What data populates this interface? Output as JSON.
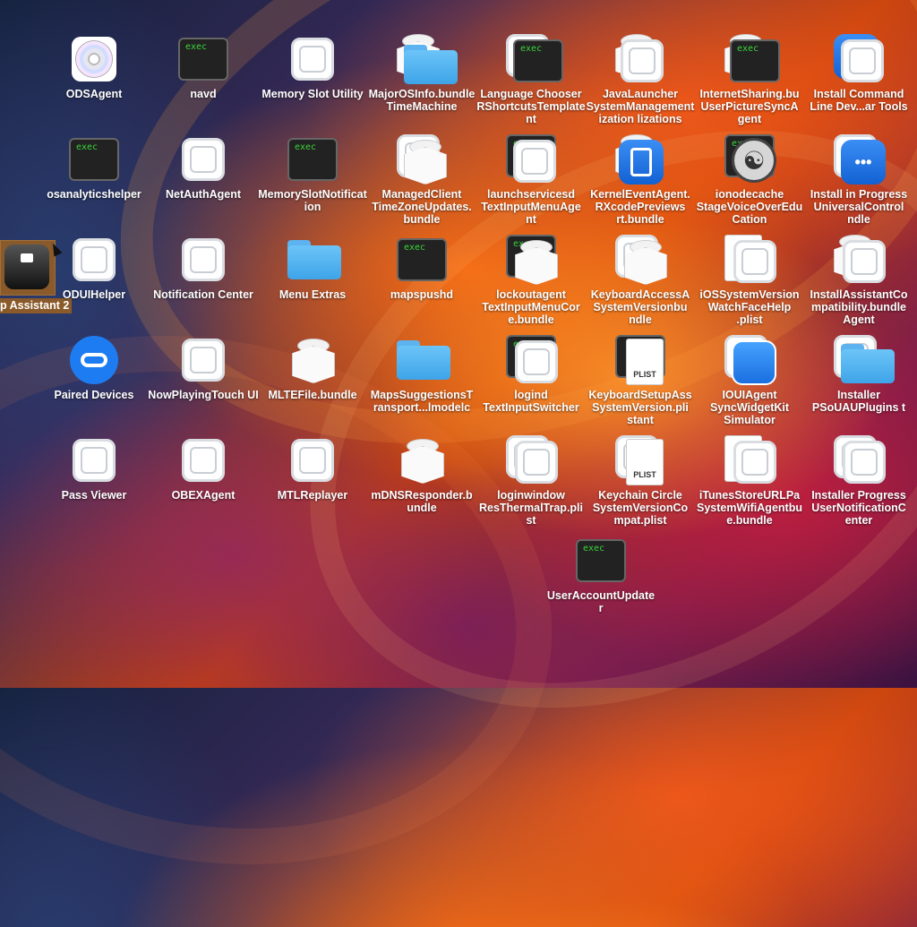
{
  "desktop": {
    "items": [
      {
        "label": "ODSAgent",
        "icon": "disc-icon"
      },
      {
        "label": "navd",
        "icon": "exec-icon"
      },
      {
        "label": "Memory Slot Utility",
        "icon": "generic-app-icon"
      },
      {
        "label": "MajorOSInfo.bundleTimeMachine",
        "icon": "folder-icon"
      },
      {
        "label": "Language Chooser RShortcutsTemplate nt",
        "icon": "exec-icon"
      },
      {
        "label": "JavaLauncher SystemManagementization lizations",
        "icon": "generic-app-icon"
      },
      {
        "label": "InternetSharing.bu UserPictureSyncA gent",
        "icon": "exec-icon"
      },
      {
        "label": "Install Command Line Dev...ar Tools",
        "icon": "generic-app-icon"
      },
      {
        "label": "osanalyticshelper",
        "icon": "exec-icon"
      },
      {
        "label": "NetAuthAgent",
        "icon": "generic-app-icon"
      },
      {
        "label": "MemorySlotNotification",
        "icon": "exec-icon"
      },
      {
        "label": "ManagedClient TimeZoneUpdates. bundle",
        "icon": "bundle-icon"
      },
      {
        "label": "launchservicesd TextInputMenuAge nt",
        "icon": "generic-app-icon"
      },
      {
        "label": "KernelEventAgent. RXcodePreviews rt.bundle",
        "icon": "blue-app-icon"
      },
      {
        "label": "ionodecache StageVoiceOverEdu Cation",
        "icon": "accessibility-icon"
      },
      {
        "label": "Install in Progress UniversalControl ndle",
        "icon": "universal-control-icon"
      },
      {
        "label": "p Assistant 2",
        "icon": "tuxedo-icon"
      },
      {
        "label": "ODUIHelper",
        "icon": "generic-app-icon"
      },
      {
        "label": "Notification Center",
        "icon": "generic-app-icon"
      },
      {
        "label": "Menu Extras",
        "icon": "folder-icon"
      },
      {
        "label": "mapspushd",
        "icon": "exec-icon"
      },
      {
        "label": "lockoutagent TextInputMenuCor e.bundle",
        "icon": "bundle-icon"
      },
      {
        "label": "KeyboardAccessA SystemVersionbu ndle",
        "icon": "bundle-icon"
      },
      {
        "label": "iOSSystemVersion WatchFaceHelp .plist",
        "icon": "generic-app-icon"
      },
      {
        "label": "InstallAssistantCo mpatibility.bundle Agent",
        "icon": "generic-app-icon"
      },
      {
        "label": "Paired Devices",
        "icon": "paired-devices-icon"
      },
      {
        "label": "NowPlayingTouch UI",
        "icon": "generic-app-icon"
      },
      {
        "label": "MLTEFile.bundle",
        "icon": "bundle-icon"
      },
      {
        "label": "MapsSuggestionsT ransport...lmodelc",
        "icon": "folder-icon"
      },
      {
        "label": "logind TextInputSwitcher",
        "icon": "generic-app-icon"
      },
      {
        "label": "KeyboardSetupAss SystemVersion.pli stant",
        "icon": "plist-icon"
      },
      {
        "label": "IOUIAgent SyncWidgetKit Simulator",
        "icon": "watch-face-icon"
      },
      {
        "label": "Installer PSoUAUPlugins t",
        "icon": "folder-icon"
      },
      {
        "label": "Pass Viewer",
        "icon": "generic-app-icon"
      },
      {
        "label": "OBEXAgent",
        "icon": "generic-app-icon"
      },
      {
        "label": "MTLReplayer",
        "icon": "generic-app-icon"
      },
      {
        "label": "mDNSResponder.b undle",
        "icon": "bundle-icon"
      },
      {
        "label": "loginwindow ResThermalTrap.pli st",
        "icon": "generic-app-icon"
      },
      {
        "label": "Keychain Circle SystemVersionCo mpat.plist",
        "icon": "plist-icon"
      },
      {
        "label": "iTunesStoreURLPa SystemWifiAgentbu e.bundle",
        "icon": "generic-app-icon"
      },
      {
        "label": "Installer Progress UserNotificationC enter",
        "icon": "generic-app-icon"
      },
      {
        "label": "UserAccountUpdater",
        "icon": "exec-icon"
      }
    ]
  },
  "exec_text": "exec",
  "plist_text": "PLIST"
}
